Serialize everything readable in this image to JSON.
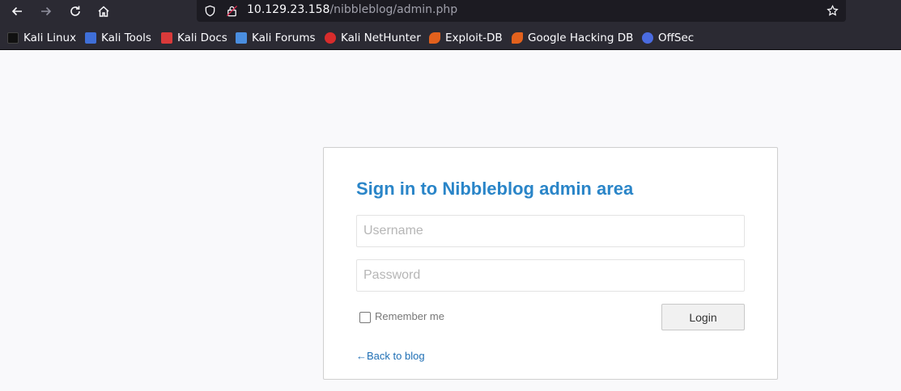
{
  "browser": {
    "url_host": "10.129.23.158",
    "url_path": "/nibbleblog/admin.php",
    "bookmarks": [
      {
        "label": "Kali Linux",
        "icon": "kali-dragon-icon",
        "color": "#1a1a1a"
      },
      {
        "label": "Kali Tools",
        "icon": "kali-tools-icon",
        "color": "#3f6fd8"
      },
      {
        "label": "Kali Docs",
        "icon": "kali-docs-icon",
        "color": "#d93a3a"
      },
      {
        "label": "Kali Forums",
        "icon": "kali-forums-icon",
        "color": "#4a8ee0"
      },
      {
        "label": "Kali NetHunter",
        "icon": "nethunter-icon",
        "color": "#d82c2c"
      },
      {
        "label": "Exploit-DB",
        "icon": "exploit-db-icon",
        "color": "#e2611d"
      },
      {
        "label": "Google Hacking DB",
        "icon": "ghdb-icon",
        "color": "#e2611d"
      },
      {
        "label": "OffSec",
        "icon": "offsec-icon",
        "color": "#4a6be0"
      }
    ]
  },
  "login": {
    "title": "Sign in to Nibbleblog admin area",
    "username_placeholder": "Username",
    "password_placeholder": "Password",
    "remember_label": "Remember me",
    "login_button": "Login",
    "back_link": "←Back to blog"
  },
  "colors": {
    "accent": "#2a85c8",
    "link": "#1f6fb5"
  }
}
